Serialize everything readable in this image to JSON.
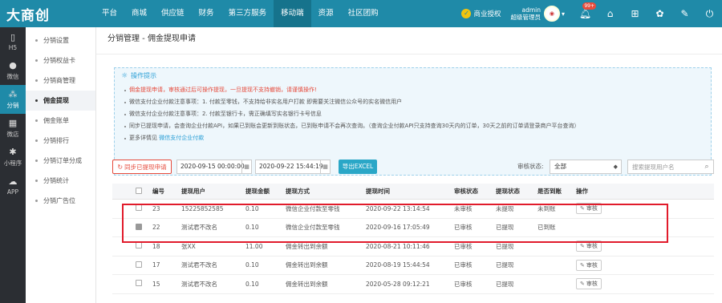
{
  "brand": {
    "logo_text": "大商创"
  },
  "nav": [
    "平台",
    "商城",
    "供应链",
    "财务",
    "第三方服务",
    "移动端",
    "资源",
    "社区团购"
  ],
  "nav_active_index": 5,
  "topbar": {
    "auth_label": "商业授权",
    "user_name": "admin",
    "user_role": "超级管理员",
    "notification_count": "99+"
  },
  "sidebar": [
    {
      "icon": "mobile-icon",
      "label": "H5"
    },
    {
      "icon": "wechat-icon",
      "label": "微信"
    },
    {
      "icon": "distribution-icon",
      "label": "分销"
    },
    {
      "icon": "store-icon",
      "label": "微店"
    },
    {
      "icon": "mini-program-icon",
      "label": "小程序"
    },
    {
      "icon": "app-icon",
      "label": "APP"
    }
  ],
  "subnav": [
    "分销设置",
    "分销权益卡",
    "分销商管理",
    "佣金提现",
    "佣金账单",
    "分销排行",
    "分销订单分成",
    "分销统计",
    "分销广告位"
  ],
  "page_title": "分销管理 - 佣金提现申请",
  "tips": {
    "title": "操作提示",
    "items": [
      "佣金提现申请，审核通过后可操作提现，一旦提现不支持撤销，请谨慎操作!",
      "微信支付企业付款注意事项：1. 付款至零钱，不支持给非实名用户打款 即需要关注微信公众号的实名微信用户",
      "微信支付企业付款注意事项：2. 付款至银行卡，需正确填写实名银行卡号信息",
      "同步已提现申请，会查询企业付款API，如果已到账会更新到账状态，已到账申请不会再次查询。（查询企业付款API只支持查询30天内的订单，30天之前的订单请登录商户平台查询）"
    ],
    "more_prefix": "更多详情见",
    "more_link": "微信支付企业付款"
  },
  "toolbar": {
    "sync_label": "同步已提现申请",
    "start_date": "2020-09-15 00:00:00",
    "end_date": "2020-09-22 15:44:19",
    "export_label": "导出EXCEL",
    "status_label": "审核状态:",
    "status_value": "全部",
    "search_placeholder": "搜索提现用户名"
  },
  "table": {
    "headers": [
      "编号",
      "提现用户",
      "提现金额",
      "提现方式",
      "提现时间",
      "审核状态",
      "提现状态",
      "是否到账",
      "操作"
    ],
    "rows": [
      {
        "id": "23",
        "user": "15225852585",
        "amount": "0.10",
        "method": "微信企业付款至零钱",
        "time": "2020-09-22 13:14:54",
        "audit": "未审核",
        "withdraw": "未提现",
        "arrived": "未到账",
        "action": "审核",
        "checkbox_disabled": false
      },
      {
        "id": "22",
        "user": "测试君不改名",
        "amount": "0.10",
        "method": "微信企业付款至零钱",
        "time": "2020-09-16 17:05:49",
        "audit": "已审核",
        "withdraw": "已提现",
        "arrived": "已到账",
        "action": "",
        "checkbox_disabled": true
      },
      {
        "id": "18",
        "user": "张XX",
        "amount": "11.00",
        "method": "佣金转出到余额",
        "time": "2020-08-21 10:11:46",
        "audit": "已审核",
        "withdraw": "已提现",
        "arrived": "",
        "action": "审核",
        "checkbox_disabled": false
      },
      {
        "id": "17",
        "user": "测试君不改名",
        "amount": "0.10",
        "method": "佣金转出到余额",
        "time": "2020-08-19 15:44:54",
        "audit": "已审核",
        "withdraw": "已提现",
        "arrived": "",
        "action": "审核",
        "checkbox_disabled": false
      },
      {
        "id": "15",
        "user": "测试君不改名",
        "amount": "0.10",
        "method": "佣金转出到余额",
        "time": "2020-05-28 09:12:21",
        "audit": "已审核",
        "withdraw": "已提现",
        "arrived": "",
        "action": "审核",
        "checkbox_disabled": false
      }
    ]
  },
  "colors": {
    "primary": "#1f8aa8",
    "danger": "#e64a3b",
    "highlight": "#e11b2b",
    "sidebar_bg": "#2b2e33"
  }
}
